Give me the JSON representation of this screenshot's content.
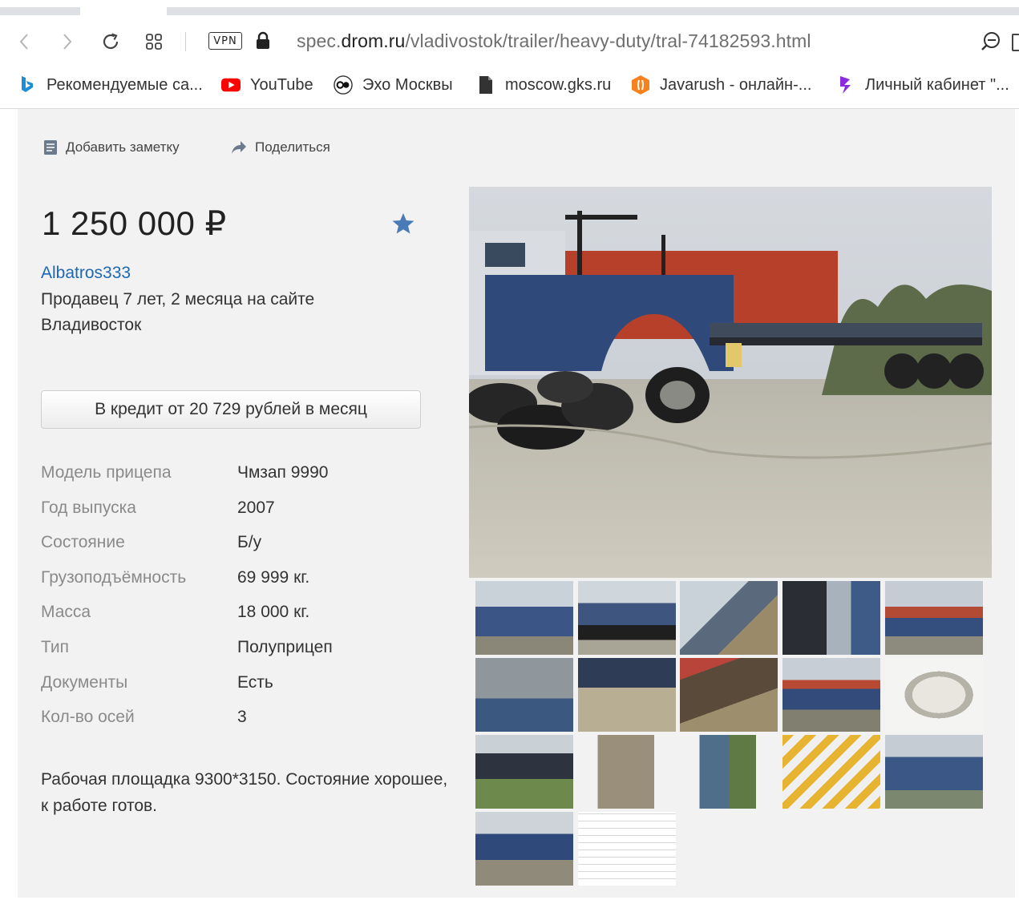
{
  "browser": {
    "url_prefix": "spec.",
    "url_host": "drom.ru",
    "url_path": "/vladivostok/trailer/heavy-duty/tral-74182593.html",
    "vpn_label": "VPN",
    "bookmarks": [
      {
        "label": "Рекомендуемые са...",
        "icon": "bing-icon"
      },
      {
        "label": "YouTube",
        "icon": "youtube-icon"
      },
      {
        "label": "Эхо Москвы",
        "icon": "echo-icon"
      },
      {
        "label": "moscow.gks.ru",
        "icon": "document-icon"
      },
      {
        "label": "Javarush - онлайн-...",
        "icon": "javarush-icon"
      },
      {
        "label": "Личный кабинет \"...",
        "icon": "cabinet-icon"
      }
    ]
  },
  "listing": {
    "add_note": "Добавить заметку",
    "share": "Поделиться",
    "price": "1 250 000 ₽",
    "seller": "Albatros333",
    "seller_since": "Продавец 7 лет, 2 месяца на сайте",
    "city": "Владивосток",
    "credit_button": "В кредит от 20 729 рублей в месяц",
    "specs": [
      {
        "label": "Модель прицепа",
        "value": "Чмзап 9990"
      },
      {
        "label": "Год выпуска",
        "value": "2007"
      },
      {
        "label": "Состояние",
        "value": "Б/у"
      },
      {
        "label": "Грузоподъёмность",
        "value": "69 999 кг."
      },
      {
        "label": "Масса",
        "value": "18 000 кг."
      },
      {
        "label": "Тип",
        "value": "Полуприцеп"
      },
      {
        "label": "Документы",
        "value": "Есть"
      },
      {
        "label": "Кол-во осей",
        "value": "3"
      }
    ],
    "description_line1": "Рабочая площадка 9300*3150. Состояние хорошее,",
    "description_line2": "к работе готов."
  },
  "colors": {
    "link": "#1d68b5",
    "star": "#4a7bb7",
    "page_bg": "#f2f2f2"
  }
}
